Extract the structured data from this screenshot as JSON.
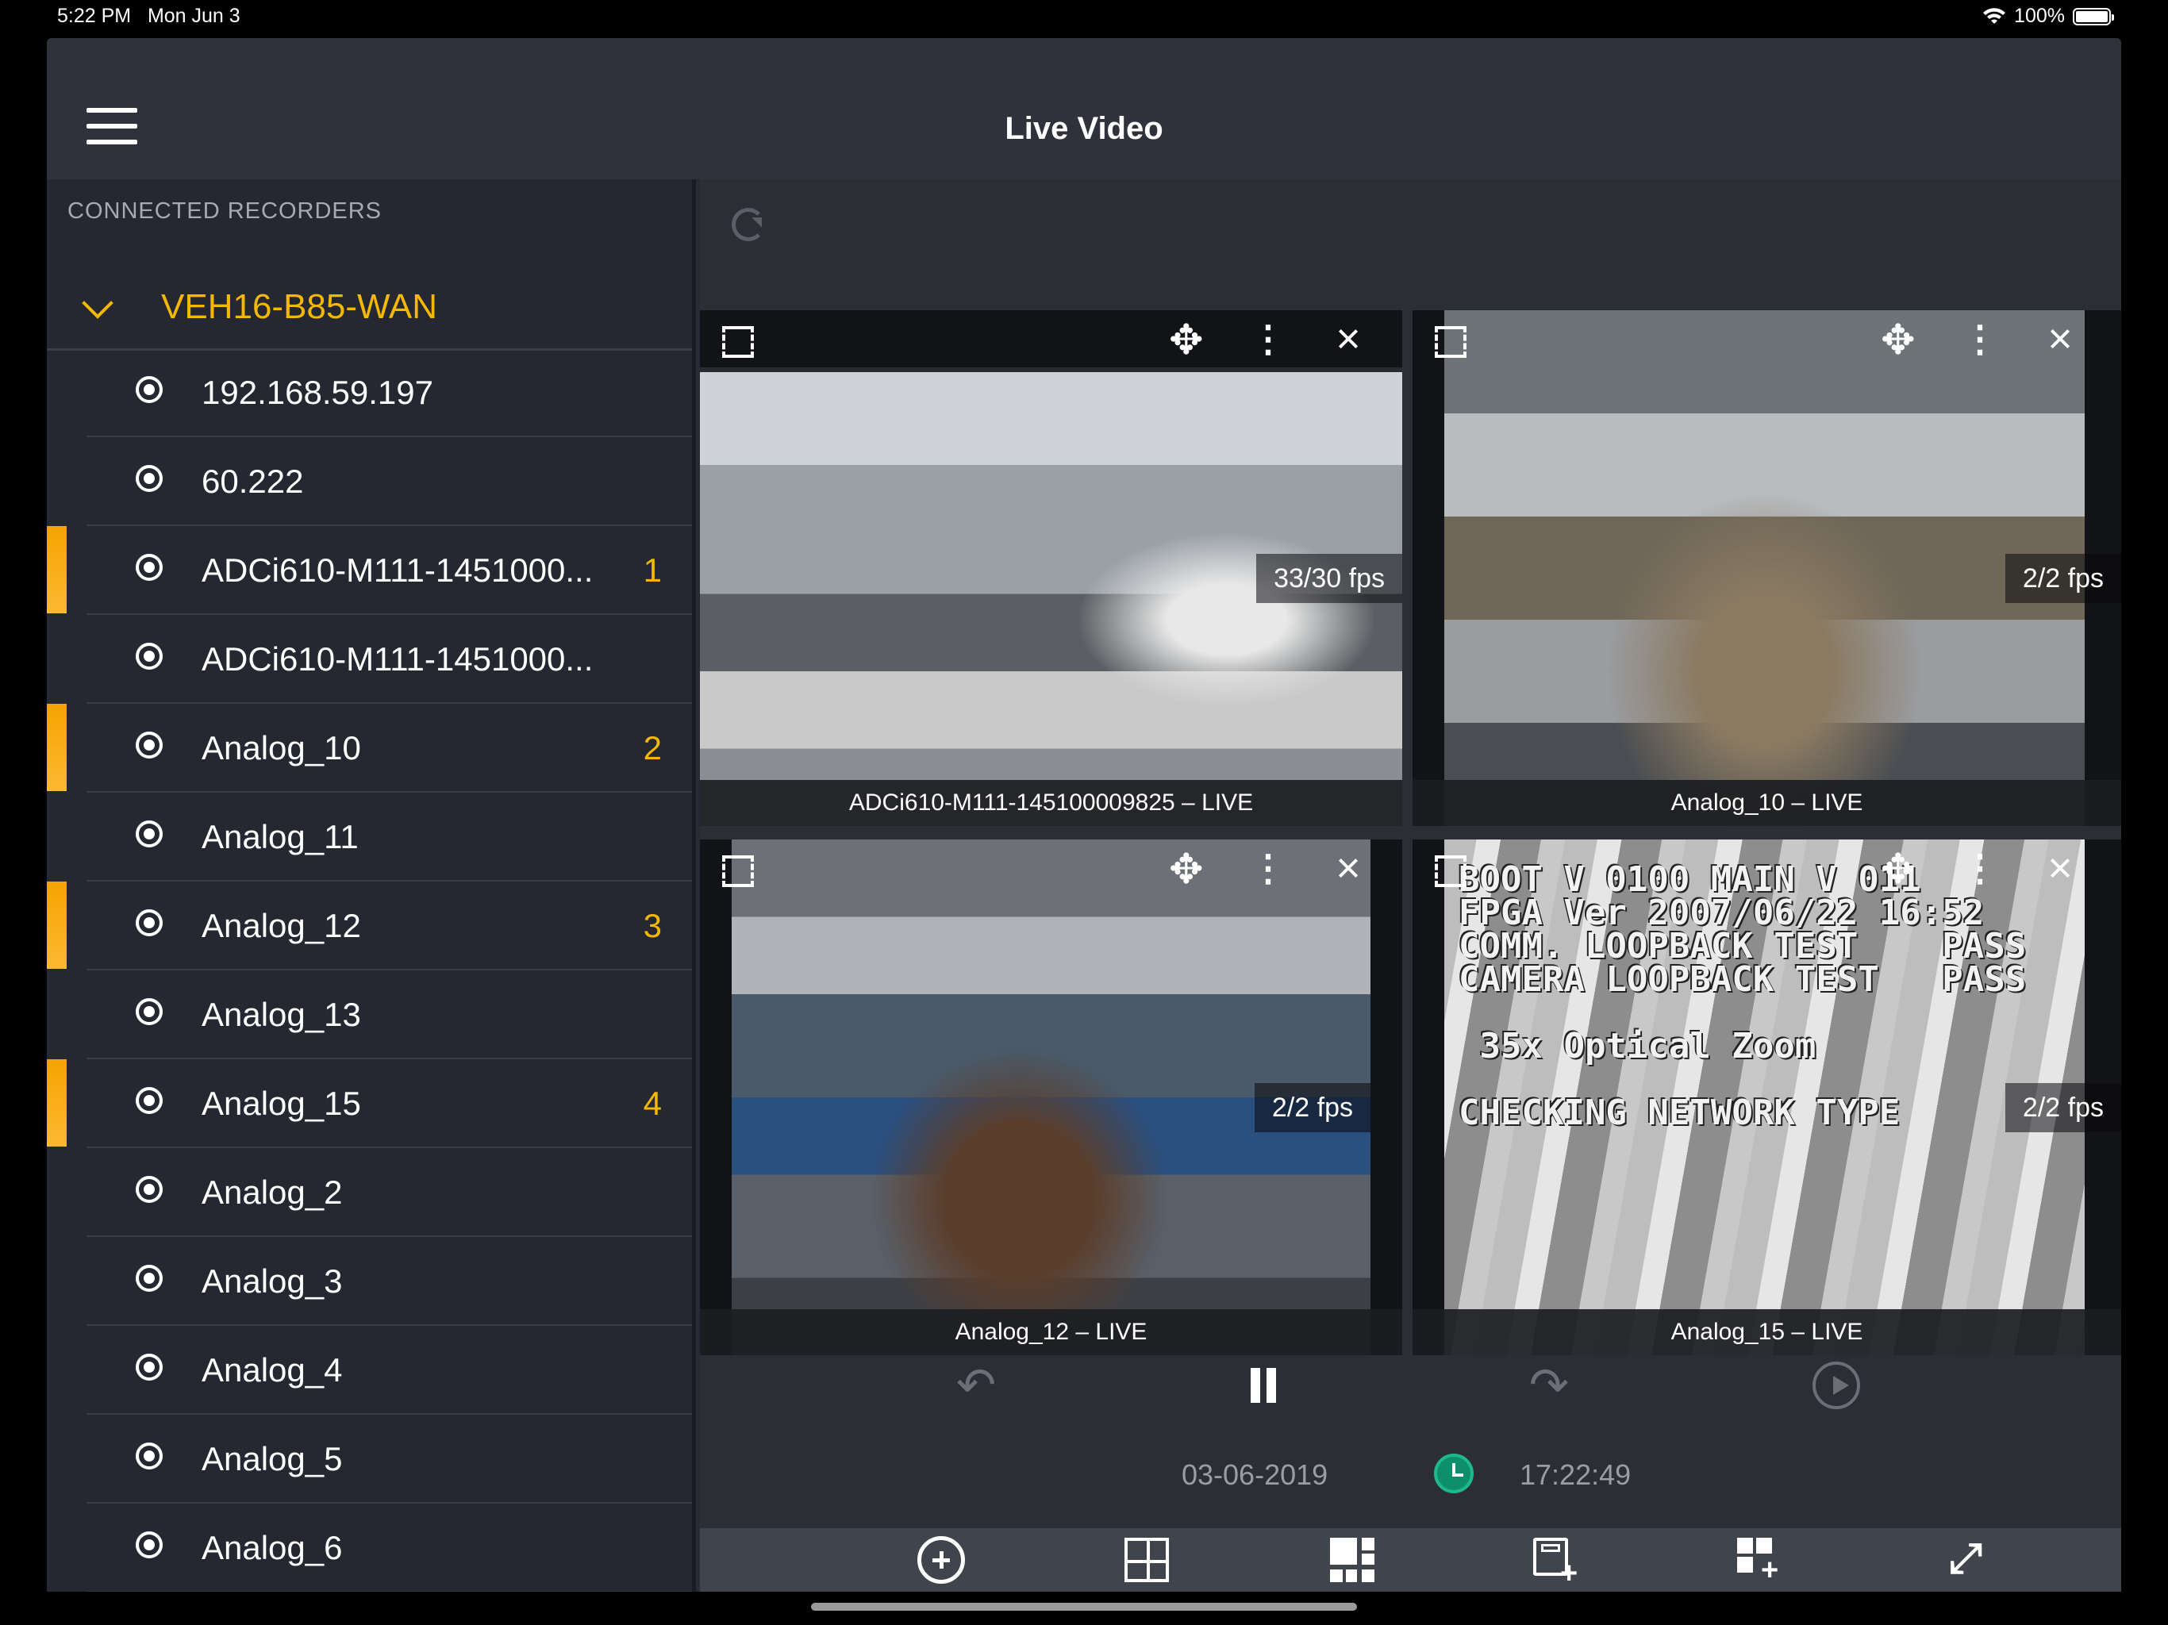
{
  "status": {
    "time": "5:22 PM",
    "date": "Mon Jun 3",
    "battery": "100%"
  },
  "header": {
    "title": "Live Video"
  },
  "sidebar": {
    "section_label": "CONNECTED RECORDERS",
    "recorder": "VEH16-B85-WAN",
    "cameras": [
      {
        "name": "192.168.59.197",
        "slot": ""
      },
      {
        "name": "60.222",
        "slot": ""
      },
      {
        "name": "ADCi610-M111-1451000...",
        "slot": "1"
      },
      {
        "name": "ADCi610-M111-1451000...",
        "slot": ""
      },
      {
        "name": "Analog_10",
        "slot": "2"
      },
      {
        "name": "Analog_11",
        "slot": ""
      },
      {
        "name": "Analog_12",
        "slot": "3"
      },
      {
        "name": "Analog_13",
        "slot": ""
      },
      {
        "name": "Analog_15",
        "slot": "4"
      },
      {
        "name": "Analog_2",
        "slot": ""
      },
      {
        "name": "Analog_3",
        "slot": ""
      },
      {
        "name": "Analog_4",
        "slot": ""
      },
      {
        "name": "Analog_5",
        "slot": ""
      },
      {
        "name": "Analog_6",
        "slot": ""
      }
    ]
  },
  "tiles": [
    {
      "fps": "33/30 fps",
      "caption": "ADCi610-M111-145100009825 – LIVE"
    },
    {
      "fps": "2/2 fps",
      "caption": "Analog_10 – LIVE"
    },
    {
      "fps": "2/2 fps",
      "caption": "Analog_12 – LIVE"
    },
    {
      "fps": "2/2 fps",
      "caption": "Analog_15 – LIVE",
      "osd": [
        "BOOT V 0100 MAIN V 011",
        "FPGA Ver 2007/06/22 16:52",
        "COMM. LOOPBACK TEST    PASS",
        "CAMERA LOOPBACK TEST   PASS",
        "",
        " 35x Optical Zoom",
        "",
        "CHECKING NETWORK TYPE"
      ]
    }
  ],
  "timeline": {
    "date": "03-06-2019",
    "time": "17:22:49"
  },
  "colors": {
    "accent": "#f5b800",
    "background": "#282b33",
    "toolbar": "#40444c",
    "clock": "#0c8f6a"
  },
  "icons": [
    "hamburger-icon",
    "chevron-down-icon",
    "radio-icon",
    "refresh-icon",
    "expand-icon",
    "move-icon",
    "more-vertical-icon",
    "close-icon",
    "rewind-icon",
    "pause-icon",
    "forward-icon",
    "play-circle-icon",
    "clock-icon",
    "add-circle-icon",
    "grid-icon",
    "layout-icon",
    "save-layout-icon",
    "add-grid-icon",
    "fullscreen-icon"
  ]
}
